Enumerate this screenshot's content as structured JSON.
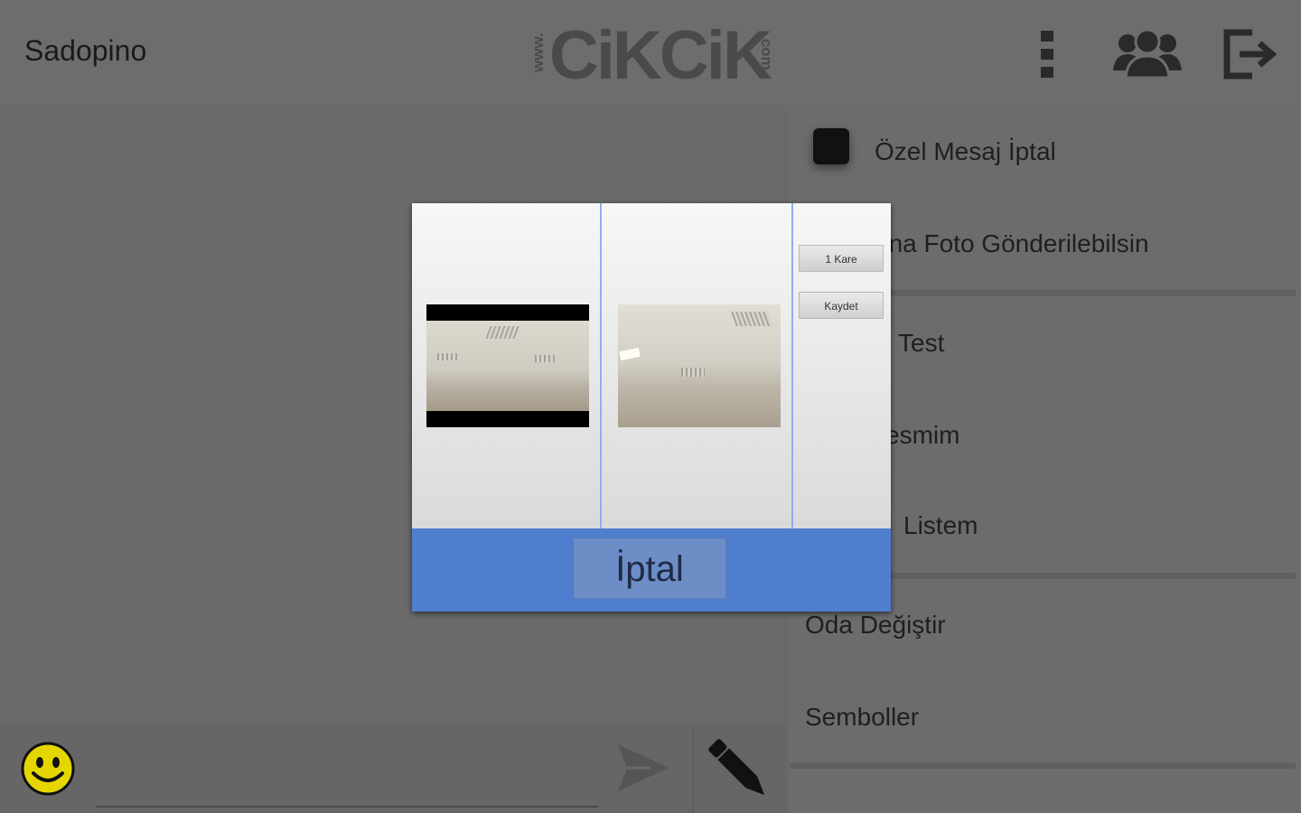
{
  "header": {
    "username": "Sadopino",
    "logo": {
      "www": "www.",
      "main": "CiKCiK",
      "com": ".com"
    },
    "icons": [
      "more-vertical-icon",
      "users-icon",
      "exit-icon"
    ]
  },
  "chat": {
    "message_value": "",
    "message_placeholder": "",
    "icons": [
      "smiley-icon",
      "send-icon",
      "pencil-icon"
    ]
  },
  "side_menu": {
    "items": [
      {
        "label": "Özel Mesaj İptal",
        "has_checkbox": true,
        "checked": true
      },
      {
        "label": "ana Foto Gönderilebilsin"
      },
      {
        "label": "Test"
      },
      {
        "label": "esmim"
      },
      {
        "label": "Listem"
      },
      {
        "label": "Oda Değiştir"
      },
      {
        "label": "Semboller"
      }
    ]
  },
  "dialog": {
    "buttons": {
      "frame": "1 Kare",
      "save": "Kaydet"
    },
    "cancel_label": "İptal"
  },
  "colors": {
    "dialog_footer": "#4f7ecf",
    "cancel_button": "#6d8dc7",
    "column_divider": "#8eb0ee",
    "overlay_gray": "#6a6a6a",
    "smiley": "#e6d600"
  }
}
